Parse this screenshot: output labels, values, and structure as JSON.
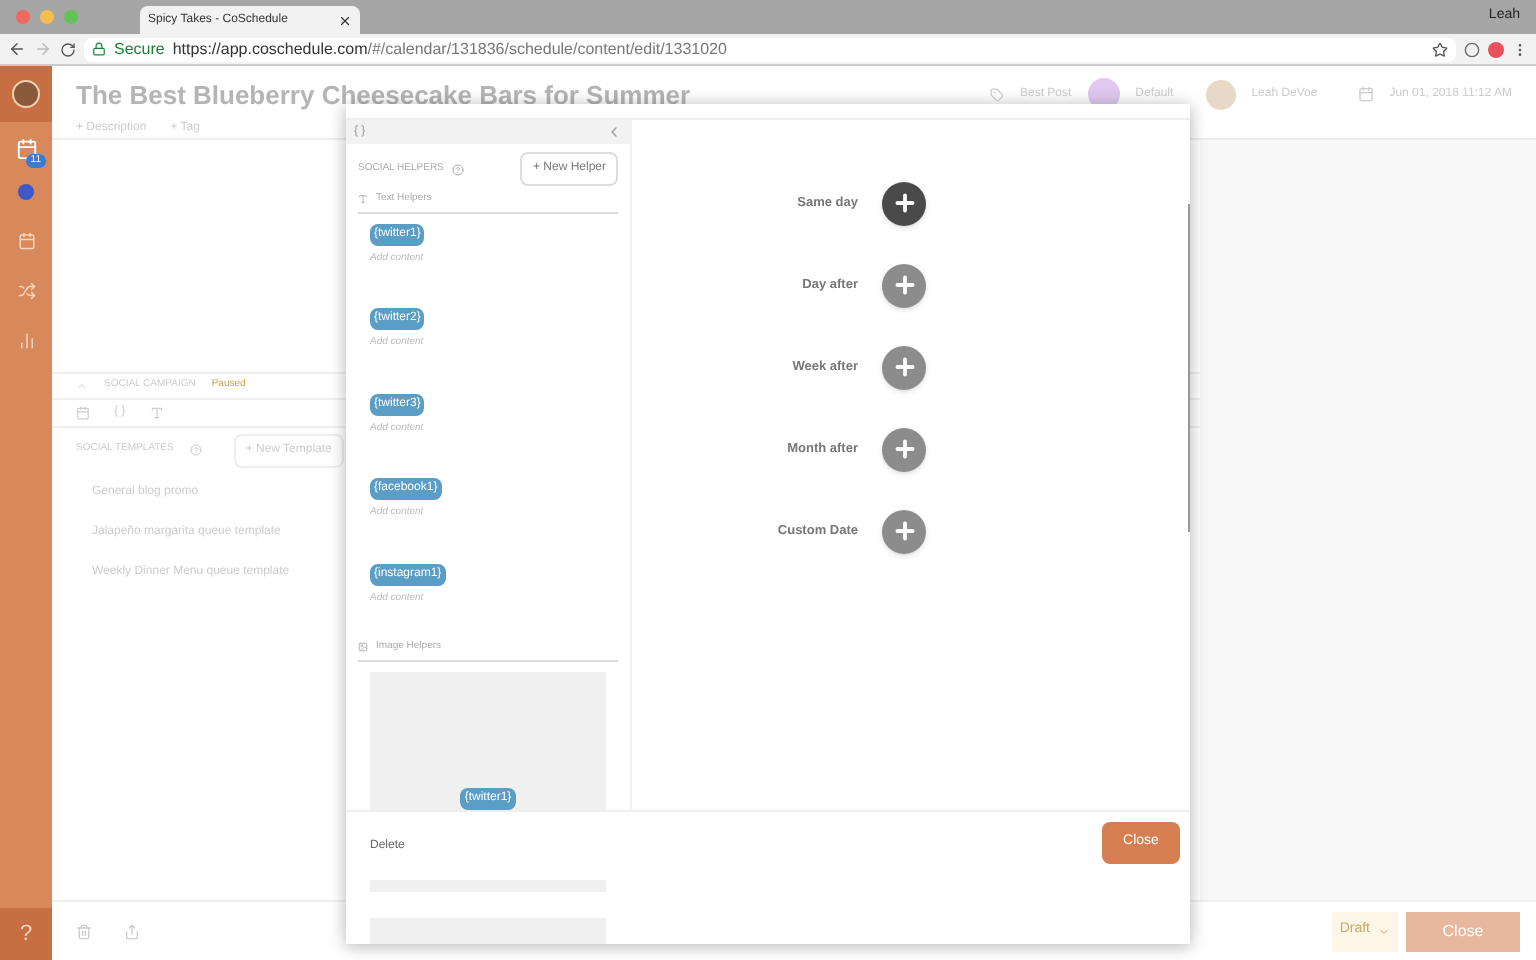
{
  "browser": {
    "tab_title": "Spicy Takes - CoSchedule",
    "user": "Leah",
    "secure": "Secure",
    "url_host": "https://app.coschedule.com",
    "url_path": "/#/calendar/131836/schedule/content/edit/1331020"
  },
  "sidebar": {
    "badge": "11",
    "help": "?"
  },
  "header": {
    "title": "The Best Blueberry Cheesecake Bars for Summer",
    "links": [
      "+ Description",
      "+ Tag"
    ],
    "best": "Best Post",
    "color_label": "Default",
    "owner": "Leah DeVoe",
    "date": "Jun 01, 2018 11:12 AM"
  },
  "campaign": {
    "label": "SOCIAL CAMPAIGN",
    "status": "Paused",
    "templates_label": "SOCIAL TEMPLATES",
    "new_template": "+ New Template",
    "templates": [
      "General blog promo",
      "Jalapeño margarita queue template",
      "Weekly Dinner Menu queue template"
    ]
  },
  "footer": {
    "draft": "Draft",
    "close": "Close"
  },
  "modal": {
    "braces": "{ }",
    "helpers_label": "SOCIAL HELPERS",
    "new_helper": "+ New Helper",
    "text_helpers": "Text Helpers",
    "helpers": [
      {
        "tag": "{twitter1}",
        "hint": "Add content"
      },
      {
        "tag": "{twitter2}",
        "hint": "Add content"
      },
      {
        "tag": "{twitter3}",
        "hint": "Add content"
      },
      {
        "tag": "{facebook1}",
        "hint": "Add content"
      },
      {
        "tag": "{instagram1}",
        "hint": "Add content"
      }
    ],
    "image_helpers": "Image Helpers",
    "image_tag": "{twitter1}",
    "delete": "Delete",
    "close": "Close",
    "timeline": [
      {
        "label": "Same day",
        "active": true
      },
      {
        "label": "Day after",
        "active": false
      },
      {
        "label": "Week after",
        "active": false
      },
      {
        "label": "Month after",
        "active": false
      },
      {
        "label": "Custom Date",
        "active": false
      }
    ]
  }
}
